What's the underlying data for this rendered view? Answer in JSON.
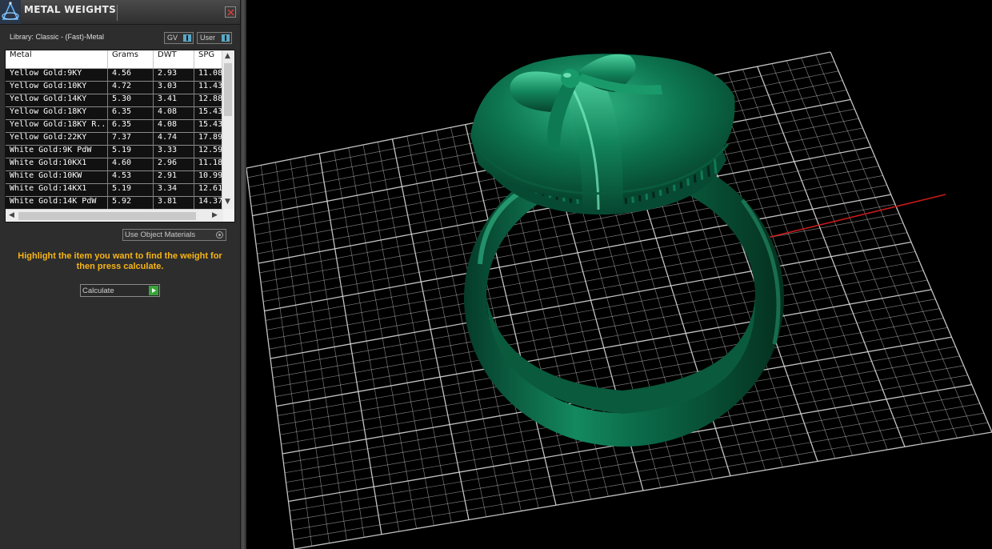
{
  "panel": {
    "title": "METAL WEIGHTS",
    "library_label": "Library: Classic - (Fast)-Metal",
    "toggles": [
      {
        "label": "GV"
      },
      {
        "label": "User"
      }
    ],
    "table": {
      "columns": [
        "Metal",
        "Grams",
        "DWT",
        "SPG"
      ],
      "rows": [
        [
          "Yellow Gold:9KY",
          "4.56",
          "2.93",
          "11.08"
        ],
        [
          "Yellow Gold:10KY",
          "4.72",
          "3.03",
          "11.43"
        ],
        [
          "Yellow Gold:14KY",
          "5.30",
          "3.41",
          "12.88"
        ],
        [
          "Yellow Gold:18KY",
          "6.35",
          "4.08",
          "15.43"
        ],
        [
          "Yellow Gold:18KY R...",
          "6.35",
          "4.08",
          "15.43"
        ],
        [
          "Yellow Gold:22KY",
          "7.37",
          "4.74",
          "17.89"
        ],
        [
          "White Gold:9K PdW",
          "5.19",
          "3.33",
          "12.59"
        ],
        [
          "White Gold:10KX1",
          "4.60",
          "2.96",
          "11.18"
        ],
        [
          "White Gold:10KW",
          "4.53",
          "2.91",
          "10.99"
        ],
        [
          "White Gold:14KX1",
          "5.19",
          "3.34",
          "12.61"
        ],
        [
          "White Gold:14K PdW",
          "5.92",
          "3.81",
          "14.37"
        ]
      ]
    },
    "use_object_materials_label": "Use Object Materials",
    "instruction_text": "Highlight the item you want to find the weight for then press calculate.",
    "calculate_label": "Calculate",
    "colors": {
      "instruction": "#f6b516",
      "accent_toggle": "#5aa9c8",
      "calc_play": "#3aa23a"
    }
  },
  "viewport": {
    "object": "ring-3d-model",
    "object_color": "#0c6b4b",
    "grid_color": "#d8d8d8",
    "x_axis_color": "#d01f1f",
    "z_axis_color": "#2e9bd6"
  }
}
